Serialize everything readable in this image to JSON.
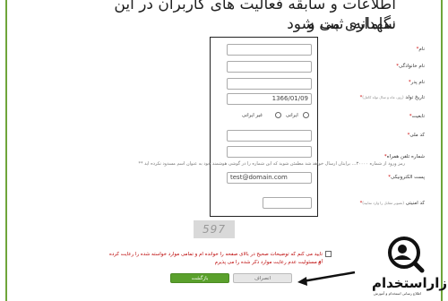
{
  "header": {
    "line1": "اطلاعات و سابقه فعالیت های کاربران در این سامانه، ثبت و",
    "line2": "نگهداری می شود"
  },
  "form": {
    "fields": [
      {
        "label": "نام",
        "value": ""
      },
      {
        "label": "نام خانوادگی",
        "value": ""
      },
      {
        "label": "نام پدر",
        "value": ""
      },
      {
        "label": "تاریخ تولد",
        "hint": "(روز، ماه و سال تولد کامل)",
        "value": "1366/01/09"
      },
      {
        "label": "تابعیت",
        "value": ""
      },
      {
        "label": "کد ملی",
        "value": ""
      },
      {
        "label": "شماره تلفن همراه",
        "value": ""
      },
      {
        "label": "پست الکترونیکی",
        "value": "test@domain.com"
      },
      {
        "label": "کد امنیتی",
        "hint": "(تصویر مقابل را وارد نمایید)",
        "value": ""
      }
    ],
    "nationality_options": [
      "ایرانی",
      "غیر ایرانی"
    ],
    "mobile_note": "** رمز ورود از شماره ۳۰۰۰۰... برایتان ارسال خواهد شد مطمئن شوید که این شماره را در گوشی هوشمند خود به عنوان اسم مسدود نکرده اید",
    "captcha_text": "597"
  },
  "agreement": {
    "line1": "تایید می کنم که توضیحات صحیح در بالای صفحه را خوانده ام و تمامی موارد خواسته شده را رعایت کرده ام",
    "line2": "و مسئولیت عدم رعایت موارد ذکر شده را می پذیرم."
  },
  "buttons": {
    "cancel": "انصراف",
    "submit": "بازگشت"
  },
  "logo": {
    "name": "بازاراستخدام",
    "tagline": "اطلاع رسانی استخدام و آموزش"
  }
}
